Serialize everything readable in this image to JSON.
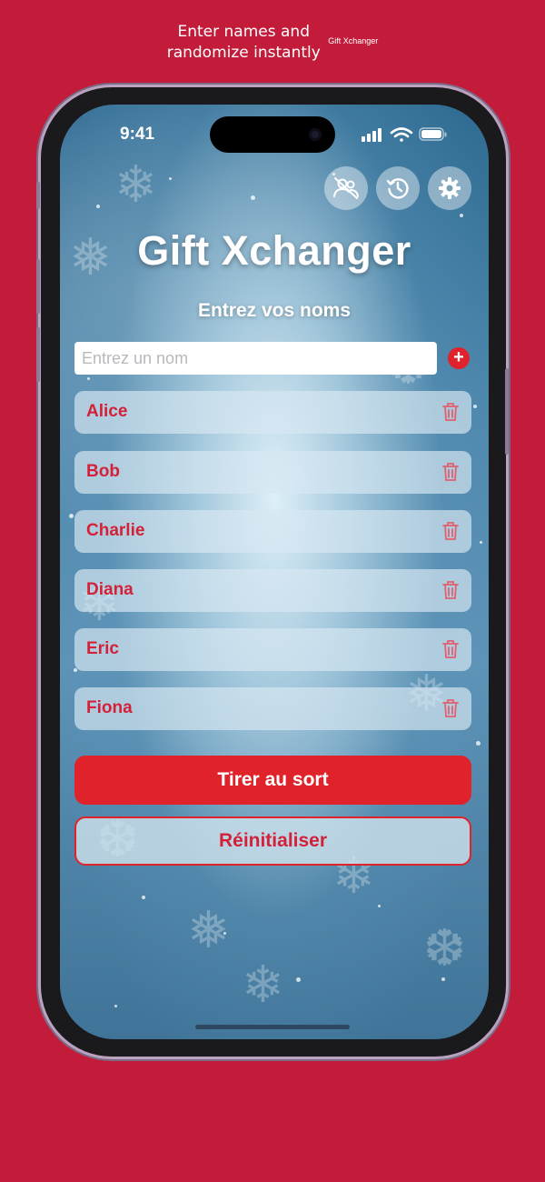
{
  "promo": {
    "headline_line1": "Enter names and",
    "headline_line2": "randomize instantly",
    "app_name": "Gift Xchanger"
  },
  "status_bar": {
    "time": "9:41"
  },
  "toolbar": {
    "icons": [
      "exclusions-icon",
      "history-icon",
      "settings-icon"
    ]
  },
  "app": {
    "title": "Gift Xchanger",
    "subtitle": "Entrez vos noms"
  },
  "input": {
    "placeholder": "Entrez un nom",
    "value": ""
  },
  "participants": [
    {
      "name": "Alice"
    },
    {
      "name": "Bob"
    },
    {
      "name": "Charlie"
    },
    {
      "name": "Diana"
    },
    {
      "name": "Eric"
    },
    {
      "name": "Fiona"
    }
  ],
  "actions": {
    "draw_label": "Tirer au sort",
    "reset_label": "Réinitialiser"
  },
  "colors": {
    "background": "#c21c3a",
    "accent": "#e0232b",
    "name_text": "#d4213a"
  }
}
